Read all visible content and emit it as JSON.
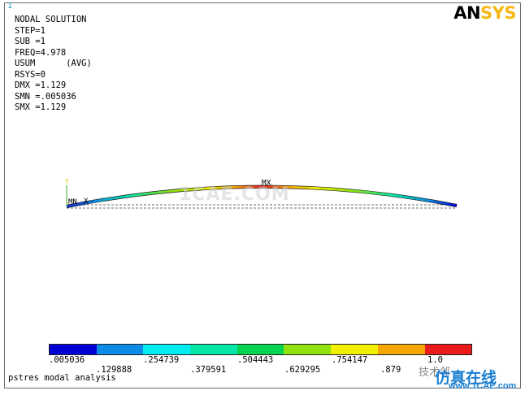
{
  "window": {
    "number": "1"
  },
  "info": {
    "lines": [
      "NODAL SOLUTION",
      "",
      "STEP=1",
      "SUB =1",
      "FREQ=4.978",
      "USUM      (AVG)",
      "RSYS=0",
      "DMX =1.129",
      "SMN =.005036",
      "SMX =1.129"
    ]
  },
  "logo": {
    "part1": "AN",
    "part2": "SYS"
  },
  "plot": {
    "axis_y_label": "Y",
    "axis_x_label": "X",
    "min_label": "MN",
    "max_label": "MX"
  },
  "watermark": "1CAE.COM",
  "legend": {
    "colors": [
      "#0000d6",
      "#0b8ae6",
      "#00ecf0",
      "#00e6a8",
      "#00d34f",
      "#8fe20c",
      "#f0f000",
      "#f5a400",
      "#e81a1a"
    ],
    "ticks_top": [
      ".005036",
      ".254739",
      ".504443",
      ".754147",
      "1.0"
    ],
    "ticks_bottom": [
      ".129888",
      ".379591",
      ".629295",
      ".879"
    ]
  },
  "footer": {
    "title": "pstres modal analysis"
  },
  "branding": {
    "prefix": "技术邻",
    "name": "仿真在线",
    "site": "www.1CAE.com"
  }
}
